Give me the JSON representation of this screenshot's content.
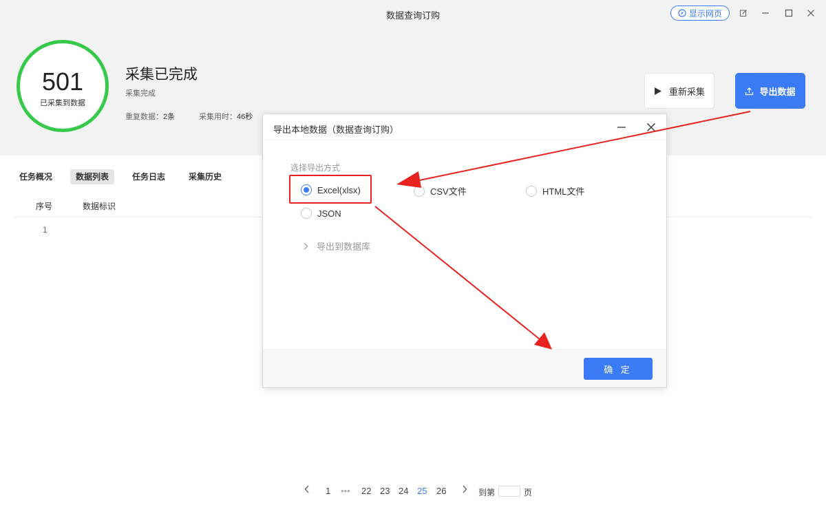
{
  "window": {
    "title": "数据查询订购",
    "show_web_label": "显示网页"
  },
  "summary": {
    "count": "501",
    "count_label": "已采集到数据",
    "status_title": "采集已完成",
    "status_sub": "采集完成",
    "stats": [
      {
        "label": "重复数据：",
        "value": "2条"
      },
      {
        "label": "采集用时：",
        "value": "46秒"
      }
    ]
  },
  "actions": {
    "recollect_label": "重新采集",
    "export_label": "导出数据"
  },
  "tabs": [
    {
      "label": "任务概况",
      "active": false
    },
    {
      "label": "数据列表",
      "active": true
    },
    {
      "label": "任务日志",
      "active": false
    },
    {
      "label": "采集历史",
      "active": false
    }
  ],
  "table": {
    "columns": [
      "序号",
      "数据标识"
    ],
    "rows": [
      {
        "index": "1"
      }
    ]
  },
  "pagination": {
    "first": "1",
    "pages": [
      "22",
      "23",
      "24",
      "25",
      "26"
    ],
    "current": "25",
    "jump_prefix": "到第",
    "jump_suffix": "页"
  },
  "dialog": {
    "title": "导出本地数据（数据查询订购）",
    "section_label": "选择导出方式",
    "options": [
      {
        "label": "Excel(xlsx)",
        "checked": true
      },
      {
        "label": "CSV文件",
        "checked": false
      },
      {
        "label": "HTML文件",
        "checked": false
      },
      {
        "label": "JSON",
        "checked": false
      }
    ],
    "db_label": "导出到数据库",
    "confirm_label": "确 定"
  },
  "colors": {
    "accent": "#3b7cf6",
    "success_ring": "#36c94a",
    "annotation": "#e8221e"
  }
}
